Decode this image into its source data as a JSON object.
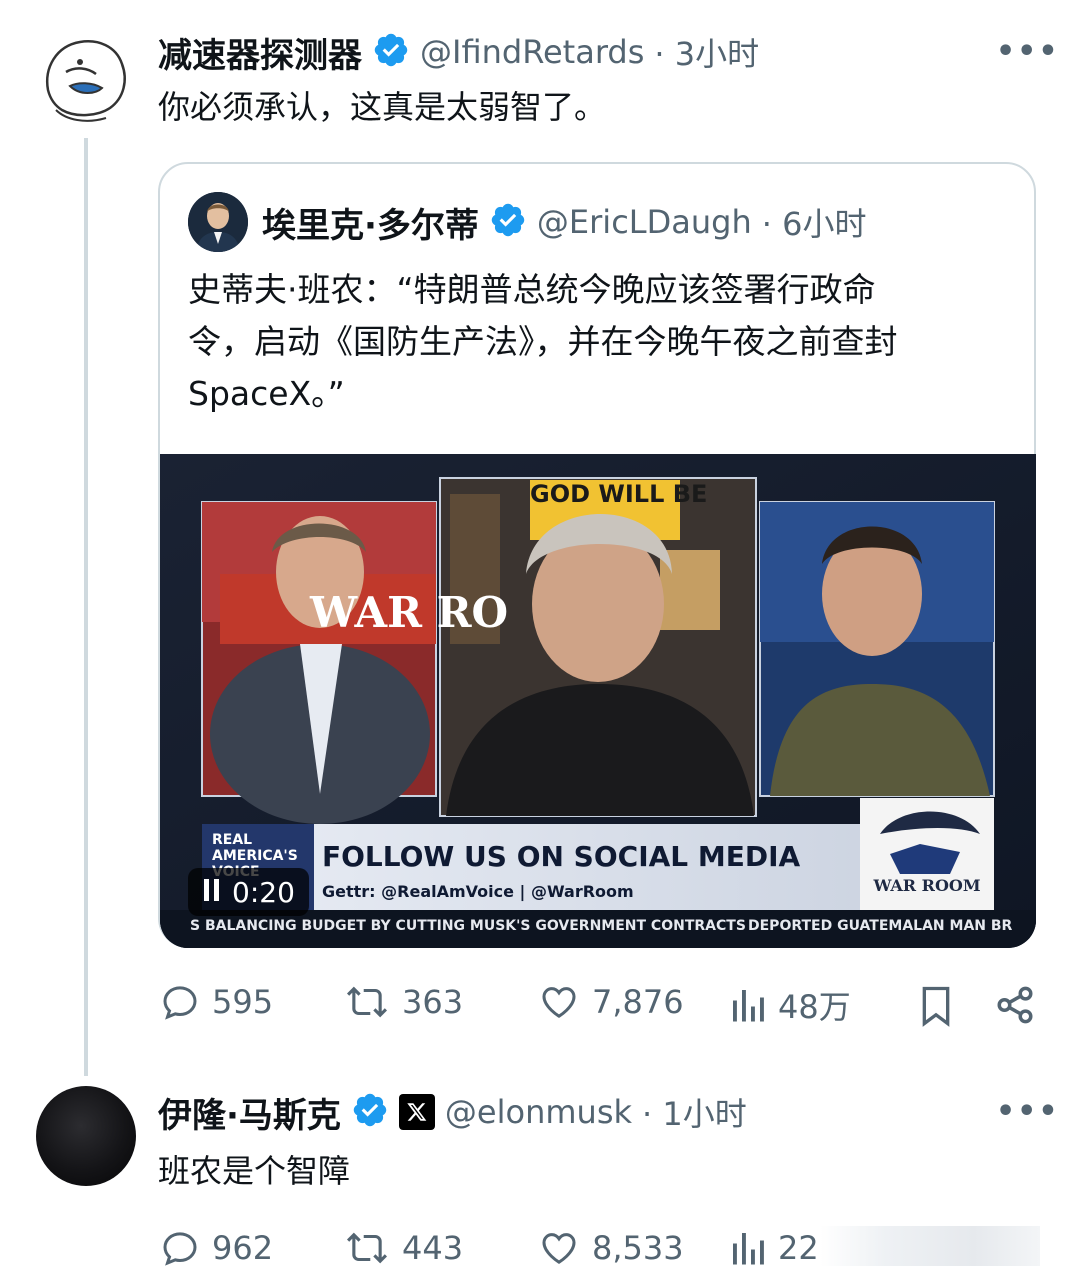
{
  "tweet1": {
    "author_name": "减速器探测器",
    "handle": "@IfindRetards",
    "time": "· 3小时",
    "text": "你必须承认，这真是太弱智了。",
    "more_label": "•••"
  },
  "quote": {
    "author_name": "埃里克·多尔蒂",
    "handle": "@EricLDaugh",
    "time": "· 6小时",
    "text_line1": "史蒂夫·班农：“特朗普总统今晚应该签署行政命",
    "text_line2": "令，启动《国防生产法》，并在今晚午夜之前查封",
    "text_line3": "SpaceX。”",
    "video": {
      "timestamp": "0:20",
      "banner_brand": "REAL AMERICA'S VOICE",
      "banner_title": "FOLLOW US ON SOCIAL MEDIA",
      "banner_sub": "Gettr: @RealAmVoice | @WarRoom",
      "ticker_left": "S BALANCING BUDGET BY CUTTING MUSK'S GOVERNMENT CONTRACTS",
      "ticker_right": "DEPORTED GUATEMALAN MAN BR",
      "logo_text": "WAR ROOM",
      "sign_text": "GOD WILL BE",
      "flag_text": "WAR RO"
    }
  },
  "actions1": {
    "replies": "595",
    "reposts": "363",
    "likes": "7,876",
    "views": "48万"
  },
  "tweet2": {
    "author_name": "伊隆·马斯克",
    "handle": "@elonmusk",
    "time": "· 1小时",
    "text": "班农是个智障",
    "more_label": "•••"
  },
  "actions2": {
    "replies": "962",
    "reposts": "443",
    "likes": "8,533",
    "views": "22"
  },
  "colors": {
    "verified_blue": "#1d9bf0",
    "text_primary": "#0f1419",
    "text_secondary": "#536471",
    "border": "#cfd9de"
  }
}
